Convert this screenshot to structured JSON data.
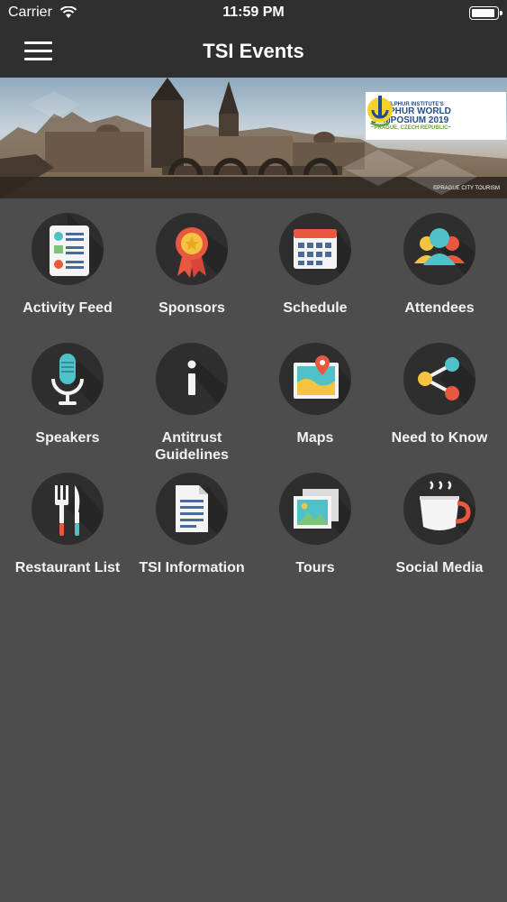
{
  "status_bar": {
    "carrier": "Carrier",
    "time": "11:59 PM"
  },
  "nav": {
    "title": "TSI Events",
    "menu_icon": "hamburger-icon"
  },
  "banner": {
    "logo_line1": "THE SULPHUR INSTITUTE'S",
    "logo_line2a": "SULPHUR WORLD",
    "logo_line2b": "SYMPOSIUM 2019",
    "logo_line3": "~PRAGUE, CZECH REPUBLIC~",
    "photo_credit": "©PRAGUE CITY TOURISM"
  },
  "tiles": [
    {
      "label": "Activity Feed",
      "icon": "activity-feed-icon"
    },
    {
      "label": "Sponsors",
      "icon": "ribbon-badge-icon"
    },
    {
      "label": "Schedule",
      "icon": "calendar-icon"
    },
    {
      "label": "Attendees",
      "icon": "people-icon"
    },
    {
      "label": "Speakers",
      "icon": "microphone-icon"
    },
    {
      "label": "Antitrust\nGuidelines",
      "icon": "info-icon"
    },
    {
      "label": "Maps",
      "icon": "map-pin-icon"
    },
    {
      "label": "Need to Know",
      "icon": "share-icon"
    },
    {
      "label": "Restaurant List",
      "icon": "fork-knife-icon"
    },
    {
      "label": "TSI Information",
      "icon": "document-icon"
    },
    {
      "label": "Tours",
      "icon": "photos-icon"
    },
    {
      "label": "Social Media",
      "icon": "coffee-cup-icon"
    }
  ],
  "colors": {
    "background": "#4d4d4d",
    "bar": "#2f2f2f",
    "icon_circle": "#2e2e2e",
    "red": "#e9573f",
    "teal": "#4fc1c9",
    "yellow": "#f5c342"
  }
}
